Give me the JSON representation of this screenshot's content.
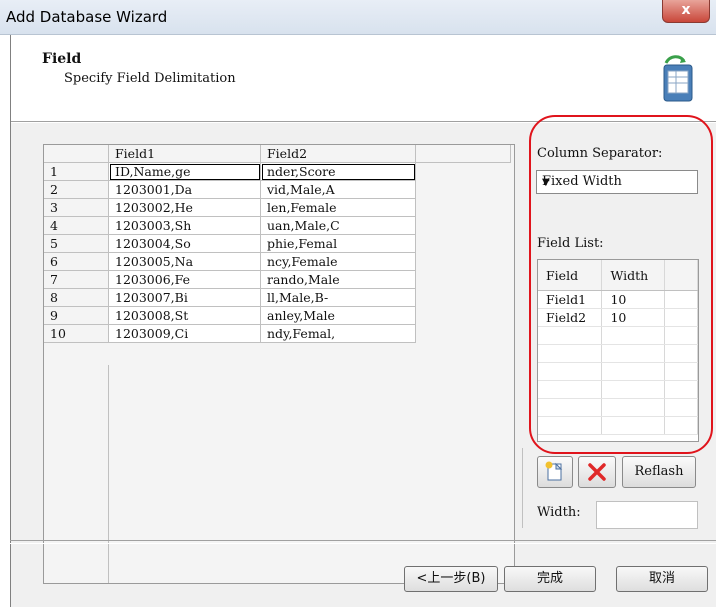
{
  "window": {
    "title": "Add Database Wizard",
    "close_glyph": "x"
  },
  "header": {
    "title": "Field",
    "subtitle": "Specify Field Delimitation",
    "icon": "database-table-icon"
  },
  "grid": {
    "columns": [
      "",
      "Field1",
      "Field2",
      ""
    ],
    "rows": [
      [
        "1",
        "ID,Name,ge",
        "nder,Score"
      ],
      [
        "2",
        "1203001,Da",
        "vid,Male,A"
      ],
      [
        "3",
        "1203002,He",
        "len,Female"
      ],
      [
        "4",
        "1203003,Sh",
        "uan,Male,C"
      ],
      [
        "5",
        "1203004,So",
        "phie,Femal"
      ],
      [
        "6",
        "1203005,Na",
        "ncy,Female"
      ],
      [
        "7",
        "1203006,Fe",
        "rando,Male"
      ],
      [
        "8",
        "1203007,Bi",
        "ll,Male,B-"
      ],
      [
        "9",
        "1203008,St",
        "anley,Male"
      ],
      [
        "10",
        "1203009,Ci",
        "ndy,Femal,"
      ]
    ]
  },
  "panel": {
    "separator_label": "Column Separator:",
    "separator_value": "Fixed Width",
    "field_list_label": "Field List:",
    "field_list": {
      "headers": [
        "Field",
        "Width"
      ],
      "rows": [
        [
          "Field1",
          "10"
        ],
        [
          "Field2",
          "10"
        ]
      ]
    },
    "refresh_label": "Reflash",
    "width_label": "Width:",
    "width_value": "",
    "highlight_color": "#e0141c"
  },
  "footer": {
    "back_label": "<上一步(B)",
    "finish_label": "完成",
    "cancel_label": "取消"
  }
}
